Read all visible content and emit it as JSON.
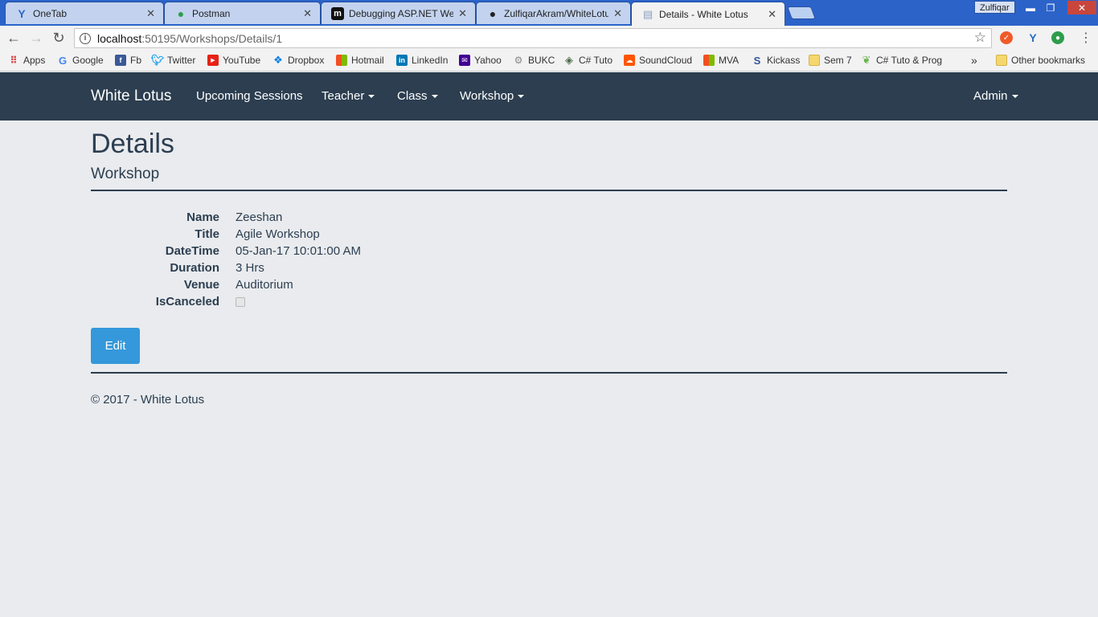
{
  "browser": {
    "tabs": [
      {
        "title": "OneTab",
        "icon": "onetab-icon",
        "color": "#2b6cc4",
        "glyph": "Y"
      },
      {
        "title": "Postman",
        "icon": "globe-icon",
        "color": "#2e9d4b",
        "glyph": "●"
      },
      {
        "title": "Debugging ASP.NET Wel",
        "icon": "medium-icon",
        "color": "#111111",
        "glyph": "m"
      },
      {
        "title": "ZulfiqarAkram/WhiteLotu",
        "icon": "github-icon",
        "color": "#222222",
        "glyph": "●"
      },
      {
        "title": "Details - White Lotus",
        "icon": "document-icon",
        "color": "#8aa0c0",
        "glyph": "▤"
      }
    ],
    "tab_close_glyph": "✕",
    "profile_name": "Zulfiqar",
    "window_controls": {
      "minimize": "▬",
      "restore": "❐",
      "close": "✕"
    },
    "url_host": "localhost",
    "url_path": ":50195/Workshops/Details/1",
    "bookmarks": [
      {
        "label": "Apps",
        "icon": "apps-grid-icon",
        "color": "#d44"
      },
      {
        "label": "Google",
        "icon": "google-icon",
        "color": "#4285f4"
      },
      {
        "label": "Fb",
        "icon": "facebook-icon",
        "color": "#3b5998"
      },
      {
        "label": "Twitter",
        "icon": "twitter-icon",
        "color": "#1da1f2"
      },
      {
        "label": "YouTube",
        "icon": "youtube-icon",
        "color": "#e62117"
      },
      {
        "label": "Dropbox",
        "icon": "dropbox-icon",
        "color": "#007ee5"
      },
      {
        "label": "Hotmail",
        "icon": "windows-icon",
        "color": "#f25022"
      },
      {
        "label": "LinkedIn",
        "icon": "linkedin-icon",
        "color": "#0077b5"
      },
      {
        "label": "Yahoo",
        "icon": "mail-icon",
        "color": "#410093"
      },
      {
        "label": "BUKC",
        "icon": "bukc-icon",
        "color": "#888888"
      },
      {
        "label": "C# Tuto",
        "icon": "diamond-icon",
        "color": "#4a6a4a"
      },
      {
        "label": "SoundCloud",
        "icon": "soundcloud-icon",
        "color": "#ff5500"
      },
      {
        "label": "MVA",
        "icon": "windows-icon",
        "color": "#7fba00"
      },
      {
        "label": "Kickass",
        "icon": "kickass-icon",
        "color": "#335599"
      },
      {
        "label": "Sem 7",
        "icon": "folder-icon",
        "color": "#f5d76e"
      },
      {
        "label": "C# Tuto & Prog",
        "icon": "leaf-icon",
        "color": "#6ab04c"
      }
    ],
    "overflow_glyph": "»",
    "other_bookmarks": "Other bookmarks"
  },
  "site": {
    "brand": "White Lotus",
    "nav": {
      "upcoming": "Upcoming Sessions",
      "teacher": "Teacher",
      "class": "Class",
      "workshop": "Workshop",
      "admin": "Admin"
    }
  },
  "page": {
    "title": "Details",
    "subtitle": "Workshop",
    "fields": [
      {
        "label": "Name",
        "value": "Zeeshan"
      },
      {
        "label": "Title",
        "value": "Agile Workshop"
      },
      {
        "label": "DateTime",
        "value": "05-Jan-17 10:01:00 AM"
      },
      {
        "label": "Duration",
        "value": "3 Hrs"
      },
      {
        "label": "Venue",
        "value": "Auditorium"
      }
    ],
    "canceled_label": "IsCanceled",
    "canceled": false,
    "edit_label": "Edit",
    "footer": "© 2017 - White Lotus"
  },
  "colors": {
    "navbar": "#2c3e50",
    "primary": "#3498db",
    "background": "#e9ebee"
  }
}
